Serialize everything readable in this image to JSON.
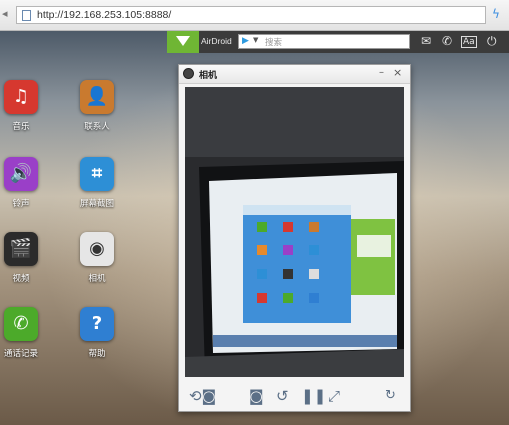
{
  "browser": {
    "url": "http://192.168.253.105:8888/"
  },
  "airdroid": {
    "brand": "AirDroid",
    "search_placeholder": "搜索"
  },
  "apps": [
    {
      "label": "音乐",
      "icon": "music-icon",
      "color": "#d6382f"
    },
    {
      "label": "联系人",
      "icon": "contacts-icon",
      "color": "#c97a2f"
    },
    {
      "label": "铃声",
      "icon": "ringtone-icon",
      "color": "#9a3fc8"
    },
    {
      "label": "屏幕截图",
      "icon": "screenshot-icon",
      "color": "#2d8fd6"
    },
    {
      "label": "视频",
      "icon": "video-icon",
      "color": "#2b2b2b"
    },
    {
      "label": "相机",
      "icon": "camera-icon",
      "color": "#e6e6e6"
    },
    {
      "label": "通话记录",
      "icon": "phone-icon",
      "color": "#4caa2a"
    },
    {
      "label": "帮助",
      "icon": "help-icon",
      "color": "#2f7fd2"
    }
  ],
  "camera_window": {
    "title": "相机"
  }
}
